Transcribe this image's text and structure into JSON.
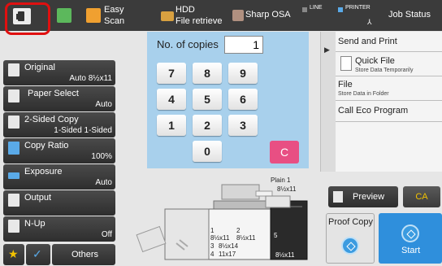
{
  "topbar": {
    "easy_scan": [
      "Easy",
      "Scan"
    ],
    "hdd": [
      "HDD",
      "File retrieve"
    ],
    "sharp_osa": "Sharp OSA",
    "line_label": "LINE",
    "printer_label": "PRINTER",
    "job_status": "Job Status"
  },
  "settings": [
    {
      "title": "Original",
      "value": "Auto  8½x11",
      "icon": "original-icon"
    },
    {
      "title": "Paper Select",
      "value": "Auto",
      "icon": "paper-icon"
    },
    {
      "title": "2-Sided Copy",
      "value": "1-Sided 1-Sided",
      "icon": "duplex-icon"
    },
    {
      "title": "Copy Ratio",
      "value": "100%",
      "icon": "ratio-icon"
    },
    {
      "title": "Exposure",
      "value": "Auto",
      "icon": "exposure-icon"
    },
    {
      "title": "Output",
      "value": "",
      "icon": "output-icon"
    },
    {
      "title": "N-Up",
      "value": "Off",
      "icon": "nup-icon"
    }
  ],
  "bottom_left": {
    "others": "Others"
  },
  "keypad": {
    "copies_label": "No. of copies",
    "copies_value": "1",
    "keys": [
      "7",
      "8",
      "9",
      "4",
      "5",
      "6",
      "1",
      "2",
      "3",
      "0"
    ],
    "clear": "C"
  },
  "right_panel": {
    "send_print": "Send and Print",
    "quick_file": "Quick File",
    "quick_file_sub": "Store Data Temporarily",
    "file": "File",
    "file_sub": "Store Data in Folder",
    "eco": "Call Eco Program"
  },
  "machine": {
    "plain_label": "Plain 1",
    "plain_size": "8½x11",
    "trays": [
      {
        "num": "1",
        "size": "8½x11"
      },
      {
        "num": "2",
        "size": "8½x11"
      },
      {
        "num": "3",
        "size": "8½x14"
      },
      {
        "num": "4",
        "size": "11x17"
      },
      {
        "num": "5",
        "size": "8½x11"
      }
    ]
  },
  "actions": {
    "preview": "Preview",
    "ca": "CA",
    "proof_copy": "Proof Copy",
    "start": "Start"
  },
  "colors": {
    "keypad_bg": "#a8d0ec",
    "clear": "#e84f83",
    "start": "#2f8fdc",
    "highlight": "#e01010",
    "ca_text": "#f2c200"
  }
}
